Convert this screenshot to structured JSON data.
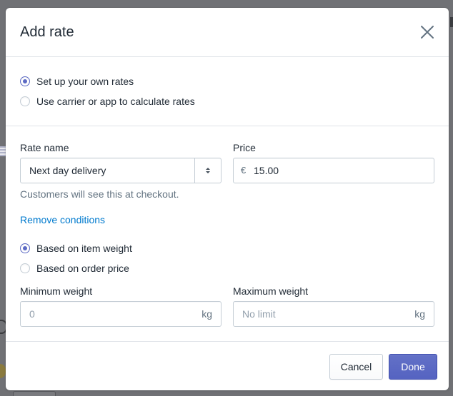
{
  "modal": {
    "title": "Add rate",
    "close_icon": "close-icon"
  },
  "rate_source": {
    "options": [
      {
        "label": "Set up your own rates",
        "checked": true
      },
      {
        "label": "Use carrier or app to calculate rates",
        "checked": false
      }
    ]
  },
  "rate_name": {
    "label": "Rate name",
    "value": "Next day delivery",
    "help": "Customers will see this at checkout."
  },
  "price": {
    "label": "Price",
    "currency": "€",
    "value": "15.00"
  },
  "conditions": {
    "remove_link": "Remove conditions",
    "options": [
      {
        "label": "Based on item weight",
        "checked": true
      },
      {
        "label": "Based on order price",
        "checked": false
      }
    ]
  },
  "min_weight": {
    "label": "Minimum weight",
    "placeholder": "0",
    "unit": "kg"
  },
  "max_weight": {
    "label": "Maximum weight",
    "placeholder": "No limit",
    "unit": "kg"
  },
  "footer": {
    "cancel_label": "Cancel",
    "done_label": "Done"
  },
  "colors": {
    "accent": "#5c6ac4",
    "link": "#007ace"
  }
}
